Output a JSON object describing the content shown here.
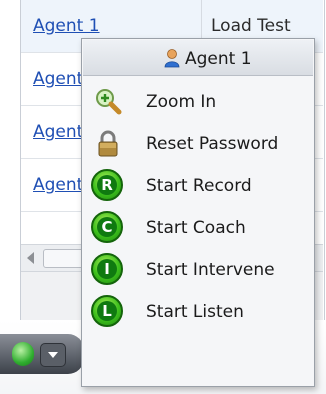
{
  "background": {
    "rows": [
      {
        "agent_link": "Agent 1",
        "other": "Load Test"
      },
      {
        "agent_link": "Agent"
      },
      {
        "agent_link": "Agent"
      },
      {
        "agent_link": "Agent"
      }
    ]
  },
  "context_menu": {
    "header": {
      "icon": "user-icon",
      "label": "Agent 1"
    },
    "items": [
      {
        "icon": "zoom-in-magnifier-icon",
        "label": "Zoom In"
      },
      {
        "icon": "lock-icon",
        "label": "Reset Password"
      },
      {
        "icon": "letter-r-icon",
        "badge_letter": "R",
        "label": "Start Record"
      },
      {
        "icon": "letter-c-icon",
        "badge_letter": "C",
        "label": "Start Coach"
      },
      {
        "icon": "letter-i-icon",
        "badge_letter": "I",
        "label": "Start Intervene"
      },
      {
        "icon": "letter-l-icon",
        "badge_letter": "L",
        "label": "Start Listen"
      }
    ]
  },
  "colors": {
    "link": "#1f4fb4",
    "menu_background": "#f5f6f8",
    "badge_green": "#3cbf1c"
  }
}
